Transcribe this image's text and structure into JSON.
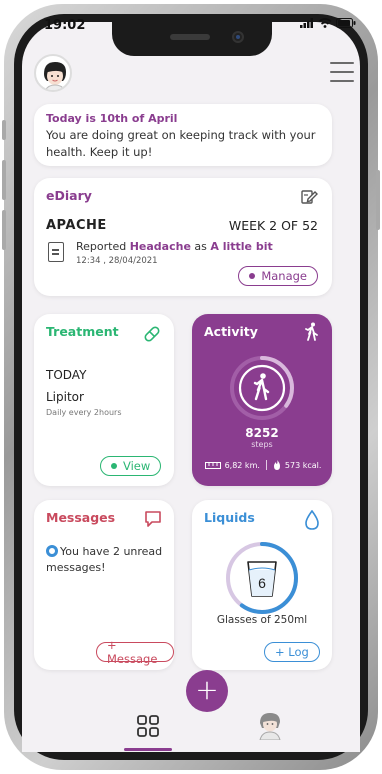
{
  "status_bar": {
    "time": "19:02"
  },
  "banner": {
    "date_text": "Today is 10th of April",
    "message": "You are doing great on keeping track with your health. Keep it up!"
  },
  "ediary": {
    "title": "eDiary",
    "study": "APACHE",
    "week": "WEEK 2 OF 52",
    "report_prefix": "Reported ",
    "symptom": "Headache",
    "report_middle": " as ",
    "severity": "A little bit",
    "timestamp": "12:34 , 28/04/2021",
    "manage_label": "Manage"
  },
  "treatment": {
    "title": "Treatment",
    "today": "TODAY",
    "drug": "Lipitor",
    "frequency": "Daily every 2hours",
    "view_label": "View"
  },
  "activity": {
    "title": "Activity",
    "steps": "8252",
    "steps_label": "steps",
    "distance": "6,82 km.",
    "calories": "573 kcal.",
    "progress": 0.35
  },
  "messages": {
    "title": "Messages",
    "unread_text": "You have 2 unread messages!",
    "button_label": "+ Message"
  },
  "liquids": {
    "title": "Liquids",
    "glasses_count": "6",
    "glasses_text": "Glasses of 250ml",
    "button_label": "+ Log",
    "progress": 0.6
  },
  "colors": {
    "brand": "#8a3d8f",
    "treatment": "#2bb673",
    "messages": "#c94a5e",
    "liquids": "#3b8fd6"
  },
  "icons": {
    "menu": "hamburger-icon",
    "ediary": "edit-icon",
    "treatment": "pill-icon",
    "activity": "walking-icon",
    "messages": "chat-icon",
    "liquids": "drop-icon",
    "fab": "plus-icon",
    "nav_home": "grid-icon",
    "nav_profile": "avatar-icon"
  }
}
